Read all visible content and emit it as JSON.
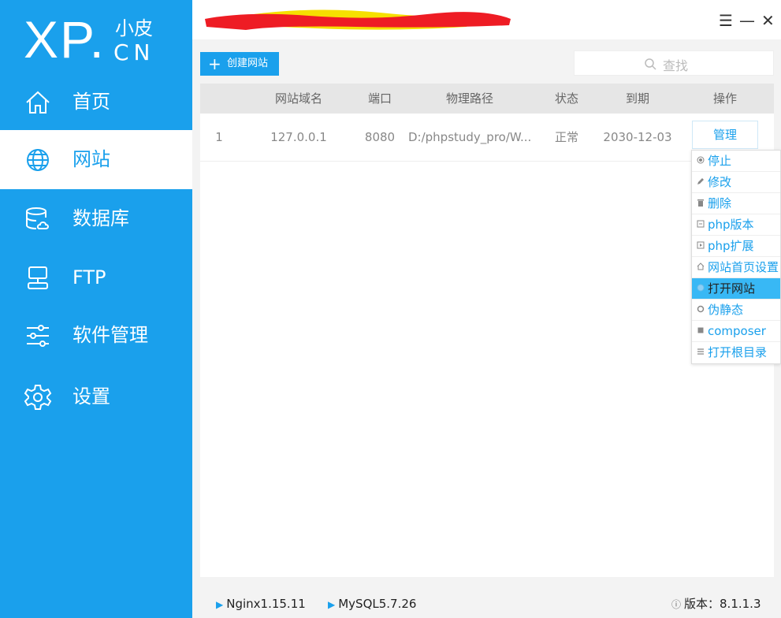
{
  "logo": {
    "brand": "XP.",
    "cn_top": "小皮",
    "cn_bottom": "CN"
  },
  "sidebar": {
    "items": [
      {
        "label": "首页",
        "icon": "home-icon"
      },
      {
        "label": "网站",
        "icon": "globe-icon",
        "active": true
      },
      {
        "label": "数据库",
        "icon": "database-icon"
      },
      {
        "label": "FTP",
        "icon": "ftp-icon"
      },
      {
        "label": "软件管理",
        "icon": "sliders-icon"
      },
      {
        "label": "设置",
        "icon": "gear-icon"
      }
    ]
  },
  "window": {
    "menu_icon": "☰",
    "minimize_icon": "—",
    "close_icon": "✕"
  },
  "toolbar": {
    "create_label": "创建网站",
    "search_placeholder": "查找"
  },
  "table": {
    "headers": [
      "网站域名",
      "端口",
      "物理路径",
      "状态",
      "到期",
      "操作"
    ],
    "rows": [
      {
        "index": "1",
        "domain": "127.0.0.1",
        "port": "8080",
        "path": "D:/phpstudy_pro/W...",
        "status": "正常",
        "expiry": "2030-12-03",
        "action": "管理"
      }
    ]
  },
  "manage_menu": {
    "items": [
      {
        "label": "停止",
        "icon": "stop-icon"
      },
      {
        "label": "修改",
        "icon": "pencil-icon"
      },
      {
        "label": "删除",
        "icon": "trash-icon"
      },
      {
        "label": "php版本",
        "icon": "php-version-icon"
      },
      {
        "label": "php扩展",
        "icon": "php-extension-icon"
      },
      {
        "label": "网站首页设置",
        "icon": "home-icon"
      },
      {
        "label": "打开网站",
        "icon": "globe-icon",
        "active": true
      },
      {
        "label": "伪静态",
        "icon": "refresh-icon"
      },
      {
        "label": "composer",
        "icon": "composer-icon"
      },
      {
        "label": "打开根目录",
        "icon": "list-icon"
      }
    ]
  },
  "footer": {
    "nginx": "Nginx1.15.11",
    "mysql": "MySQL5.7.26",
    "version": "版本：8.1.1.3"
  },
  "colors": {
    "accent": "#1aa0ec",
    "menu_active": "#38b8f5"
  }
}
